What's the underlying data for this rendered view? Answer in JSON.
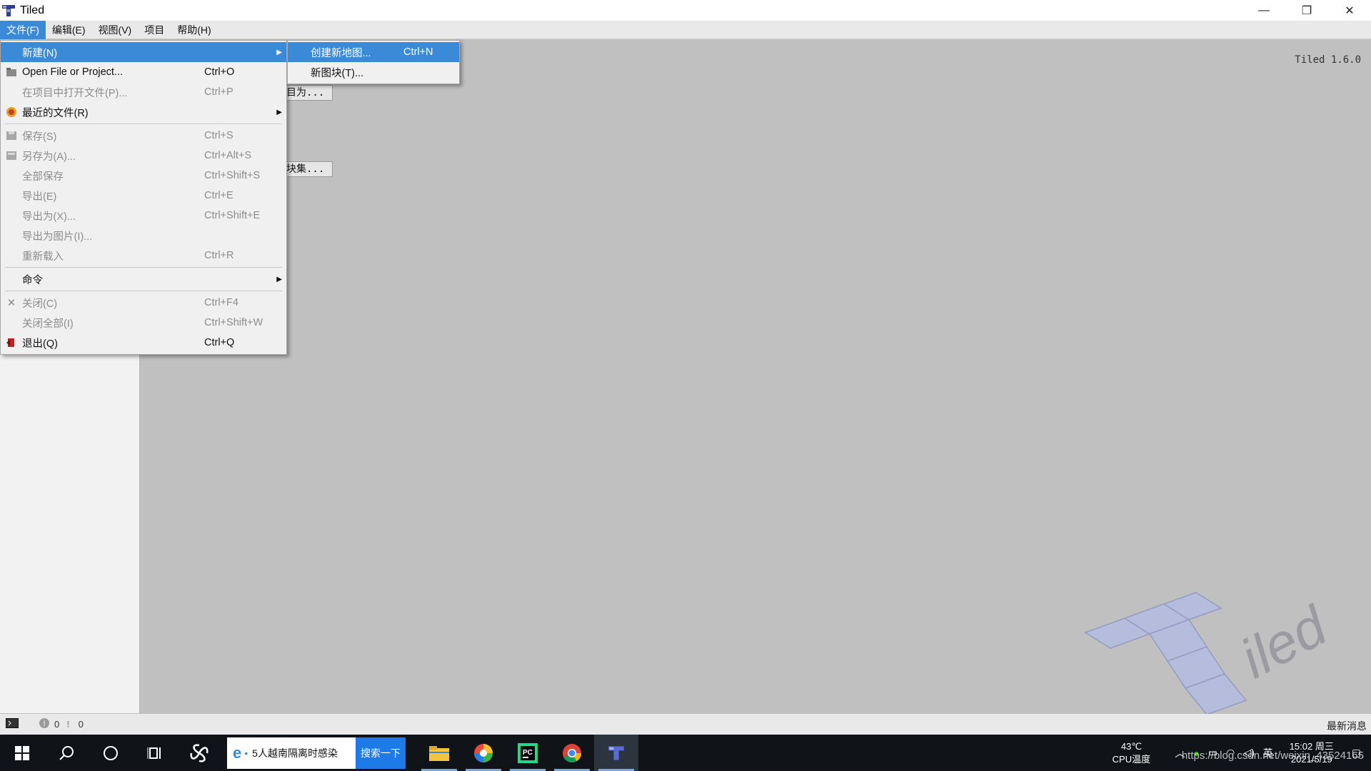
{
  "window": {
    "title": "Tiled",
    "version": "Tiled 1.6.0"
  },
  "menubar": [
    {
      "label": "文件(F)"
    },
    {
      "label": "编辑(E)"
    },
    {
      "label": "视图(V)"
    },
    {
      "label": "项目"
    },
    {
      "label": "帮助(H)"
    }
  ],
  "background_buttons": {
    "save_as_peek": "目为...",
    "tileset_peek": "块集..."
  },
  "file_menu": {
    "items": [
      {
        "label": "新建(N)",
        "shortcut": "",
        "submenu": true
      },
      {
        "label": "Open File or Project...",
        "shortcut": "Ctrl+O"
      },
      {
        "label": "在项目中打开文件(P)...",
        "shortcut": "Ctrl+P"
      },
      {
        "label": "最近的文件(R)",
        "shortcut": "",
        "submenu": true
      },
      {
        "label": "保存(S)",
        "shortcut": "Ctrl+S"
      },
      {
        "label": "另存为(A)...",
        "shortcut": "Ctrl+Alt+S"
      },
      {
        "label": "全部保存",
        "shortcut": "Ctrl+Shift+S"
      },
      {
        "label": "导出(E)",
        "shortcut": "Ctrl+E"
      },
      {
        "label": "导出为(X)...",
        "shortcut": "Ctrl+Shift+E"
      },
      {
        "label": "导出为图片(I)...",
        "shortcut": ""
      },
      {
        "label": "重新载入",
        "shortcut": "Ctrl+R"
      },
      {
        "label": "命令",
        "shortcut": "",
        "submenu": true
      },
      {
        "label": "关闭(C)",
        "shortcut": "Ctrl+F4"
      },
      {
        "label": "关闭全部(I)",
        "shortcut": "Ctrl+Shift+W"
      },
      {
        "label": "退出(Q)",
        "shortcut": "Ctrl+Q"
      }
    ]
  },
  "new_submenu": {
    "items": [
      {
        "label": "创建新地图...",
        "shortcut": "Ctrl+N"
      },
      {
        "label": "新图块(T)...",
        "shortcut": ""
      }
    ]
  },
  "statusbar": {
    "errors": "0",
    "warnings": "0",
    "news": "最新消息"
  },
  "taskbar": {
    "search_text": "5人越南隔离时感染",
    "search_button": "搜索一下",
    "cpu_temp": "43℃",
    "cpu_label": "CPU温度",
    "ime": "英",
    "time": "15:02 周三",
    "date": "2021/5/19"
  },
  "watermark": "https://blog.csdn.net/weixin_43524165",
  "colors": {
    "accent": "#3a8ad8",
    "canvas": "#c0c0c0",
    "taskbar": "#101418"
  }
}
